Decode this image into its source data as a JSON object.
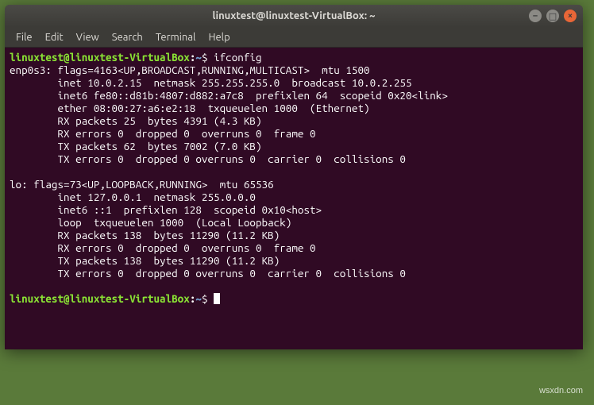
{
  "window": {
    "title": "linuxtest@linuxtest-VirtualBox: ~"
  },
  "menubar": {
    "items": [
      "File",
      "Edit",
      "View",
      "Search",
      "Terminal",
      "Help"
    ]
  },
  "prompt": {
    "userhost": "linuxtest@linuxtest-VirtualBox",
    "colon": ":",
    "path": "~",
    "dollar": "$"
  },
  "commands": {
    "cmd1": "ifconfig"
  },
  "output": {
    "l01": "enp0s3: flags=4163<UP,BROADCAST,RUNNING,MULTICAST>  mtu 1500",
    "l02": "        inet 10.0.2.15  netmask 255.255.255.0  broadcast 10.0.2.255",
    "l03": "        inet6 fe80::d81b:4807:d882:a7c8  prefixlen 64  scopeid 0x20<link>",
    "l04": "        ether 08:00:27:a6:e2:18  txqueuelen 1000  (Ethernet)",
    "l05": "        RX packets 25  bytes 4391 (4.3 KB)",
    "l06": "        RX errors 0  dropped 0  overruns 0  frame 0",
    "l07": "        TX packets 62  bytes 7002 (7.0 KB)",
    "l08": "        TX errors 0  dropped 0 overruns 0  carrier 0  collisions 0",
    "l09": "",
    "l10": "lo: flags=73<UP,LOOPBACK,RUNNING>  mtu 65536",
    "l11": "        inet 127.0.0.1  netmask 255.0.0.0",
    "l12": "        inet6 ::1  prefixlen 128  scopeid 0x10<host>",
    "l13": "        loop  txqueuelen 1000  (Local Loopback)",
    "l14": "        RX packets 138  bytes 11290 (11.2 KB)",
    "l15": "        RX errors 0  dropped 0  overruns 0  frame 0",
    "l16": "        TX packets 138  bytes 11290 (11.2 KB)",
    "l17": "        TX errors 0  dropped 0 overruns 0  carrier 0  collisions 0",
    "l18": ""
  },
  "watermark": "wsxdn.com"
}
